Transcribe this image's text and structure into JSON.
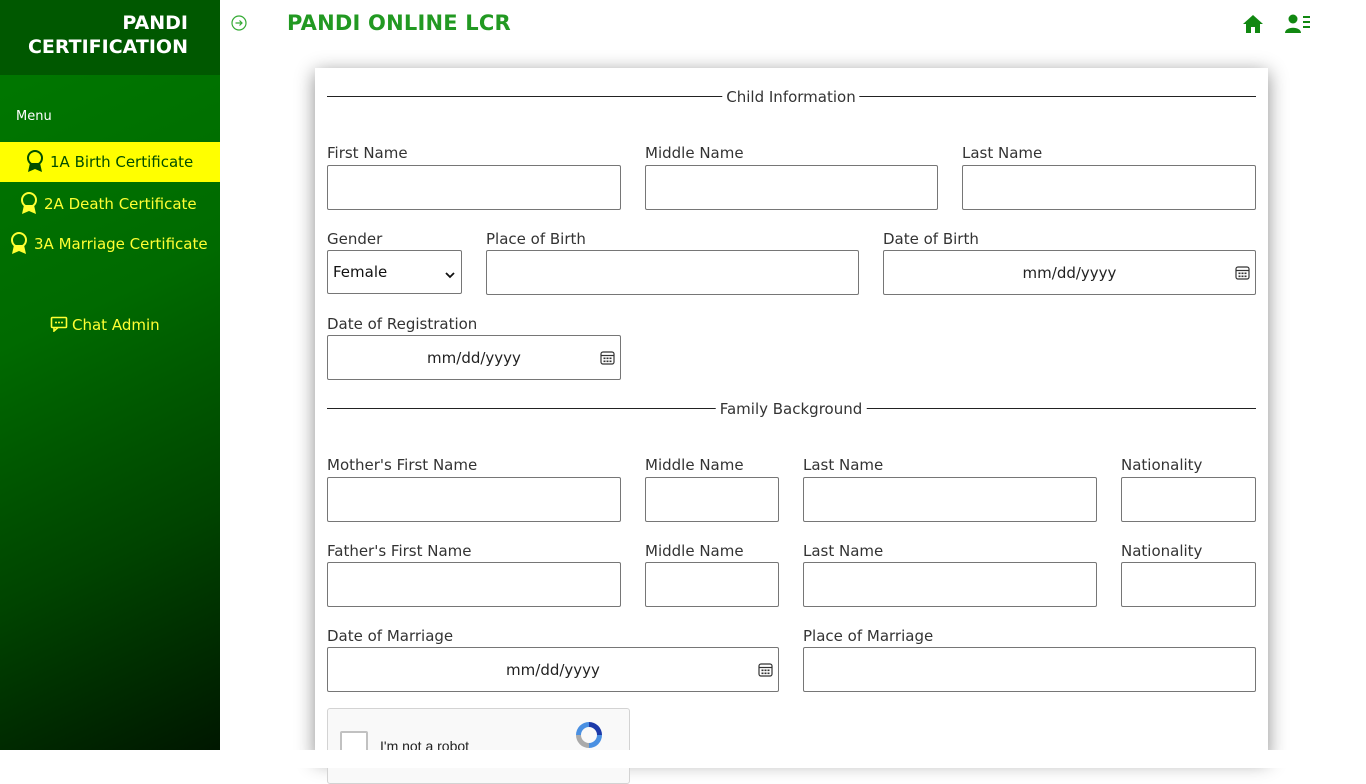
{
  "sidebar": {
    "brand": "PANDI CERTIFICATION",
    "menu_title": "Menu",
    "items": [
      {
        "label": "1A Birth Certificate",
        "icon": "award-icon",
        "active": true
      },
      {
        "label": "2A Death Certificate",
        "icon": "award-icon",
        "active": false
      },
      {
        "label": "3A Marriage Certificate",
        "icon": "award-icon",
        "active": false
      }
    ],
    "chat": {
      "label": "Chat Admin",
      "icon": "chat-icon"
    }
  },
  "header": {
    "title": "PANDI ONLINE LCR",
    "icons": [
      "arrow-right-circle-icon",
      "home-icon",
      "user-list-icon"
    ]
  },
  "colors": {
    "sidebar_dark": "#005800",
    "accent_yellow": "#ffff00",
    "title_green": "#229922"
  },
  "form": {
    "child_section": "Child Information",
    "first_name": "First Name",
    "middle_name": "Middle Name",
    "last_name": "Last Name",
    "gender": "Gender",
    "gender_value": "Female",
    "place_of_birth": "Place of Birth",
    "date_of_birth": "Date of Birth",
    "date_placeholder": "mm/dd/yyyy",
    "date_of_registration": "Date of Registration",
    "family_section": "Family Background",
    "mother_first_name": "Mother's First Name",
    "father_first_name": "Father's First Name",
    "nationality": "Nationality",
    "date_of_marriage": "Date of Marriage",
    "place_of_marriage": "Place of Marriage"
  },
  "captcha": {
    "label": "I'm not a robot"
  }
}
